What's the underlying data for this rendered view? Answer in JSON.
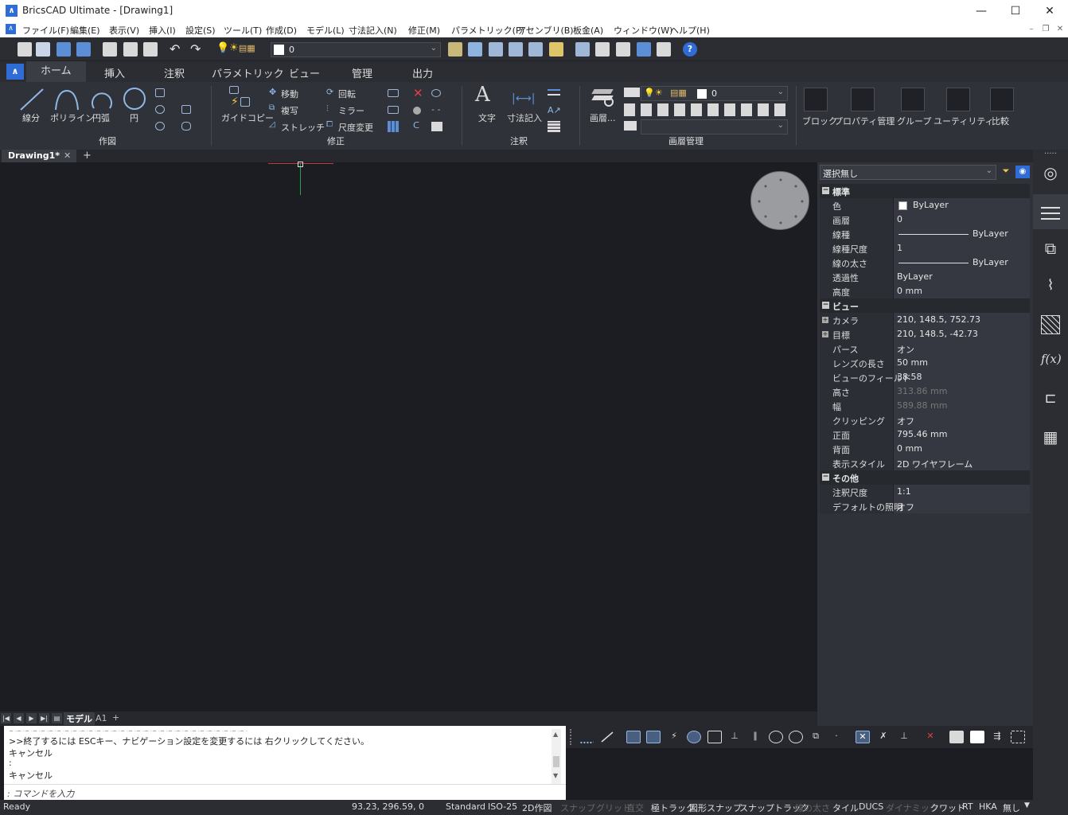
{
  "window": {
    "title": "BricsCAD Ultimate - [Drawing1]",
    "min": "—",
    "max": "☐",
    "close": "✕"
  },
  "menu": [
    "ファイル(F)",
    "編集(E)",
    "表示(V)",
    "挿入(I)",
    "設定(S)",
    "ツール(T)",
    "作成(D)",
    "モデル(L)",
    "寸法記入(N)",
    "修正(M)",
    "パラメトリック(P)",
    "アセンブリ(B)",
    "板金(A)",
    "ウィンドウ(W)",
    "ヘルプ(H)"
  ],
  "quick_access": {
    "layer_value": "0"
  },
  "ribbon_tabs": [
    "ホーム",
    "挿入",
    "注釈",
    "パラメトリック",
    "ビュー",
    "管理",
    "出力"
  ],
  "ribbon": {
    "draw": {
      "line": "線分",
      "polyline": "ポリライン",
      "arc": "円弧",
      "circle": "円",
      "panel": "作図"
    },
    "modify": {
      "guide_copy": "ガイドコピー",
      "move": "移動",
      "copy": "複写",
      "stretch": "ストレッチ",
      "rotate": "回転",
      "mirror": "ミラー",
      "scale": "尺度変更",
      "panel": "修正"
    },
    "annot": {
      "text": "文字",
      "dimension": "寸法記入",
      "panel": "注釈"
    },
    "layers": {
      "layer": "画層...",
      "value": "0",
      "panel": "画層管理"
    },
    "big": [
      "ブロック",
      "プロパティ管理",
      "グループ",
      "ユーティリティ",
      "比較"
    ]
  },
  "doc_tab": "Drawing1*",
  "layout_tabs": {
    "model": "モデル",
    "a1": "A1",
    "add": "+"
  },
  "command": {
    "lines": [
      ">>終了するには ESCキー、ナビゲーション設定を変更するには 右クリックしてください。",
      "キャンセル",
      ":",
      "キャンセル"
    ],
    "prompt": ": コマンドを入力"
  },
  "status": {
    "ready": "Ready",
    "coords": "93.23, 296.59, 0",
    "items": [
      {
        "label": "Standard",
        "on": true
      },
      {
        "label": "ISO-25",
        "on": true
      },
      {
        "label": "2D作図",
        "on": true
      },
      {
        "label": "スナップ",
        "on": false
      },
      {
        "label": "グリッド",
        "on": false
      },
      {
        "label": "直交",
        "on": false
      },
      {
        "label": "極トラック",
        "on": true
      },
      {
        "label": "図形スナップ",
        "on": true
      },
      {
        "label": "スナップトラック",
        "on": true
      },
      {
        "label": "線の太さ",
        "on": false
      },
      {
        "label": "タイル",
        "on": true
      },
      {
        "label": "DUCS",
        "on": true
      },
      {
        "label": "ダイナミック",
        "on": false
      },
      {
        "label": "クワッド",
        "on": true
      },
      {
        "label": "RT",
        "on": true
      },
      {
        "label": "HKA",
        "on": true
      },
      {
        "label": "無し",
        "on": true
      }
    ]
  },
  "properties": {
    "selection": "選択無し",
    "sections": [
      {
        "title": "標準",
        "rows": [
          {
            "k": "色",
            "v": "ByLayer",
            "swatch": true
          },
          {
            "k": "画層",
            "v": "0"
          },
          {
            "k": "線種",
            "v": "ByLayer",
            "line": true
          },
          {
            "k": "線種尺度",
            "v": "1"
          },
          {
            "k": "線の太さ",
            "v": "ByLayer",
            "line": true
          },
          {
            "k": "透過性",
            "v": "ByLayer"
          },
          {
            "k": "高度",
            "v": "0 mm"
          }
        ]
      },
      {
        "title": "ビュー",
        "rows": [
          {
            "k": "カメラ",
            "v": "210, 148.5, 752.73",
            "plus": true
          },
          {
            "k": "目標",
            "v": "210, 148.5, -42.73",
            "plus": true
          },
          {
            "k": "パース",
            "v": "オン"
          },
          {
            "k": "レンズの長さ",
            "v": "50 mm"
          },
          {
            "k": "ビューのフィールド",
            "v": "38.58"
          },
          {
            "k": "高さ",
            "v": "313.86 mm",
            "dis": true
          },
          {
            "k": "幅",
            "v": "589.88 mm",
            "dis": true
          },
          {
            "k": "クリッピング",
            "v": "オフ"
          },
          {
            "k": "正面",
            "v": "795.46 mm"
          },
          {
            "k": "背面",
            "v": "0 mm"
          },
          {
            "k": "表示スタイル",
            "v": "2D ワイヤフレーム"
          }
        ]
      },
      {
        "title": "その他",
        "rows": [
          {
            "k": "注釈尺度",
            "v": "1:1"
          },
          {
            "k": "デフォルトの照明",
            "v": "オフ"
          }
        ]
      }
    ]
  }
}
